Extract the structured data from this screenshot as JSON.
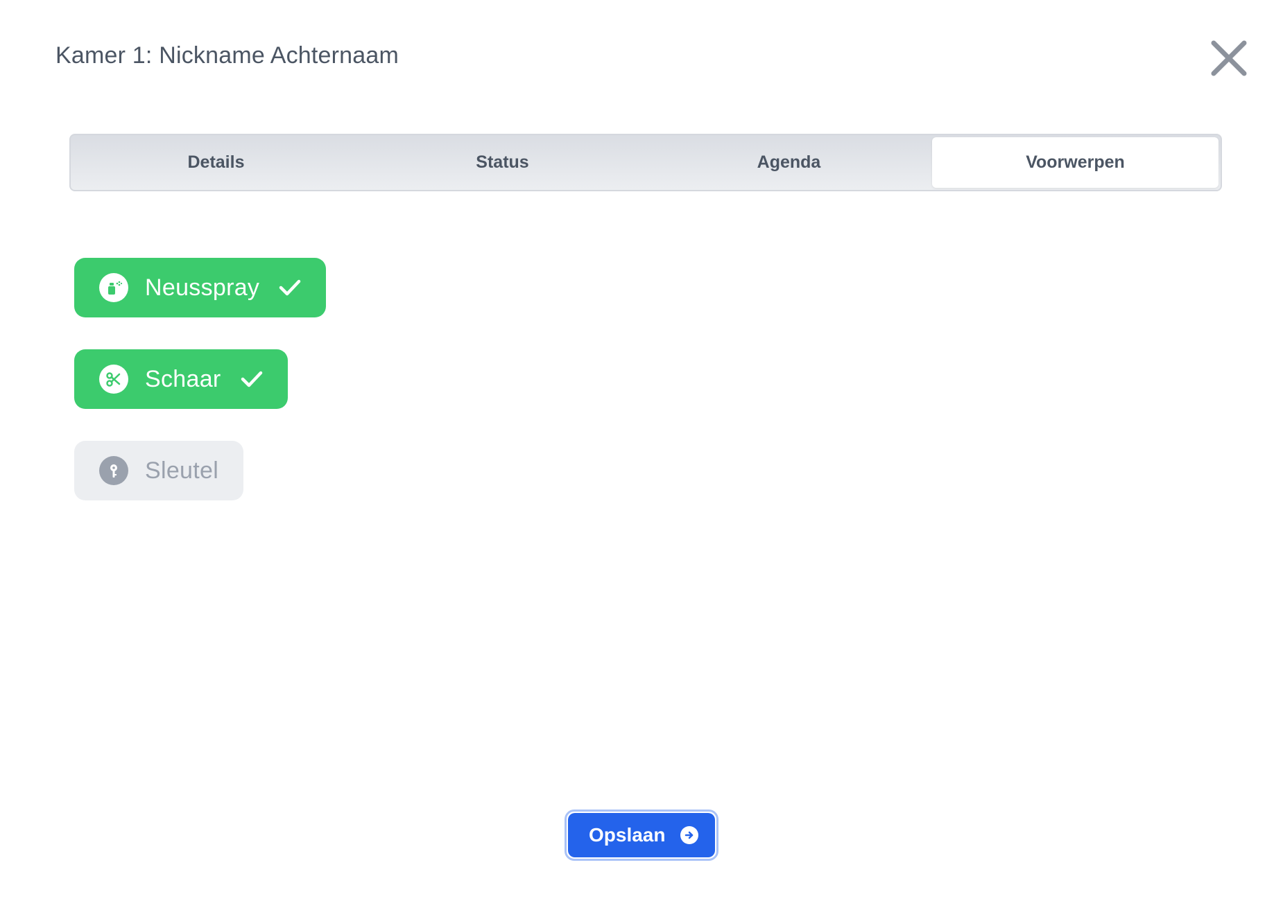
{
  "header": {
    "title": "Kamer 1: Nickname Achternaam",
    "close_icon": "close-icon"
  },
  "tabs": [
    {
      "label": "Details",
      "active": false
    },
    {
      "label": "Status",
      "active": false
    },
    {
      "label": "Agenda",
      "active": false
    },
    {
      "label": "Voorwerpen",
      "active": true
    }
  ],
  "items": [
    {
      "label": "Neusspray",
      "icon": "spray-icon",
      "checked": true
    },
    {
      "label": "Schaar",
      "icon": "scissors-icon",
      "checked": true
    },
    {
      "label": "Sleutel",
      "icon": "key-icon",
      "checked": false
    }
  ],
  "footer": {
    "save_label": "Opslaan",
    "save_icon": "arrow-right-circle-icon"
  },
  "colors": {
    "active_green": "#3ccb6d",
    "inactive_gray": "#eceef1",
    "primary_blue": "#2463eb",
    "text_dark": "#4b5563"
  }
}
